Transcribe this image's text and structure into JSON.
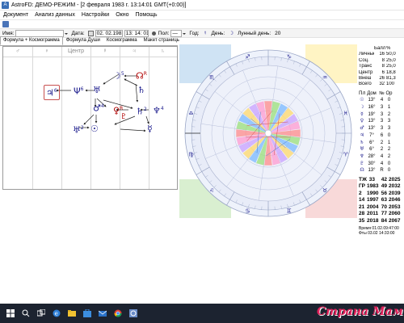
{
  "window": {
    "title": "AstroFD: ДЕМО-РЕЖИМ - [2 февраля 1983 г. 13:14:01 GMT(+0:00)]"
  },
  "menu": [
    "Документ",
    "Анализ данных",
    "Настройки",
    "Окно",
    "Помощь"
  ],
  "fields": {
    "name_label": "Имя:",
    "name_value": "",
    "date_label": "Дата:",
    "date_value": "02. 02.1983",
    "time_value": "13: 14: 01",
    "sex_label": "Пол:",
    "sex_value": "—",
    "year_label": "Год:",
    "day_label": "День:",
    "lunar_label": "Лунный день:",
    "lunar_value": "20"
  },
  "tabs": [
    "Формула + Космограмма",
    "Формула Души",
    "Космограмма",
    "Макет страницы"
  ],
  "formula": {
    "column_headers": [
      "♂",
      "♀",
      "Центр",
      "☿",
      "♃",
      "♄"
    ],
    "planets": [
      {
        "symbol": "♃",
        "sup": "6",
        "boxed": true,
        "red": false
      },
      {
        "symbol": "Ψ",
        "sup": "6",
        "boxed": false,
        "red": false
      },
      {
        "symbol": "♅",
        "sup": "",
        "boxed": false,
        "red": false
      },
      {
        "symbol": "☽",
        "sup": "5",
        "boxed": false,
        "red": false
      },
      {
        "symbol": "☊",
        "sup": "R",
        "boxed": false,
        "red": true
      },
      {
        "symbol": "♄",
        "sup": "",
        "boxed": false,
        "red": false
      },
      {
        "symbol": "♂",
        "sup": "4",
        "boxed": false,
        "red": false
      },
      {
        "symbol": "♀",
        "sup": "R",
        "boxed": false,
        "red": true
      },
      {
        "symbol": "♇",
        "sup": "",
        "boxed": false,
        "red": false
      },
      {
        "symbol": "♄",
        "sup": "2",
        "boxed": false,
        "red": false
      },
      {
        "symbol": "♆",
        "sup": "4",
        "boxed": false,
        "red": false
      },
      {
        "symbol": "♅",
        "sup": "2",
        "boxed": false,
        "red": false
      },
      {
        "symbol": "☉",
        "sup": "",
        "boxed": false,
        "red": false
      },
      {
        "symbol": "☿",
        "sup": "",
        "boxed": false,
        "red": false
      }
    ]
  },
  "stats": {
    "header": [
      "",
      "Балл",
      "%"
    ],
    "rows": [
      [
        "Личные",
        "16",
        "50,0"
      ],
      [
        "Соц.",
        "8",
        "25,0"
      ],
      [
        "Транс",
        "8",
        "25,0"
      ],
      [
        "Центр",
        "6",
        "18,8"
      ],
      [
        "Внеш",
        "26",
        "81,3"
      ],
      [
        "Всего",
        "32",
        "100"
      ]
    ]
  },
  "planet_table": {
    "header": [
      "Пл",
      "Дом",
      "№",
      "Ор"
    ],
    "rows": [
      [
        "☉",
        "13°",
        "4",
        "0"
      ],
      [
        "☽",
        "16°",
        "3",
        "1"
      ],
      [
        "☿",
        "19°",
        "3",
        "2"
      ],
      [
        "♀",
        "13°",
        "3",
        "3"
      ],
      [
        "♂",
        "13°",
        "3",
        "3"
      ],
      [
        "♃",
        "7°",
        "6",
        "0"
      ],
      [
        "♄",
        "6°",
        "2",
        "1"
      ],
      [
        "♅",
        "6°",
        "2",
        "2"
      ],
      [
        "♆",
        "28°",
        "4",
        "2"
      ],
      [
        "♇",
        "30°",
        "4",
        "0"
      ],
      [
        "☊",
        "13°",
        "R",
        "0"
      ]
    ]
  },
  "years": [
    [
      "ТЖ",
      "33",
      "42",
      "2025"
    ],
    [
      "ГР",
      "1983",
      "49",
      "2032"
    ],
    [
      "2",
      "1990",
      "56",
      "2039"
    ],
    [
      "14",
      "1997",
      "63",
      "2046"
    ],
    [
      "21",
      "2004",
      "70",
      "2053"
    ],
    [
      "28",
      "2011",
      "77",
      "2060"
    ],
    [
      "35",
      "2018",
      "84",
      "2067"
    ]
  ],
  "times": [
    "Время 01.02.09:47:00",
    "Фты 03.02 14:33:00"
  ],
  "taskbar": [
    "start",
    "search",
    "task-view",
    "edge",
    "explorer",
    "store",
    "mail",
    "chrome",
    "astro"
  ],
  "watermark": "Страна Мам",
  "zodiac": [
    "♈",
    "♉",
    "♊",
    "♋",
    "♌",
    "♍",
    "♎",
    "♏",
    "♐",
    "♑",
    "♒",
    "♓"
  ],
  "colors": {
    "planet": "#1a1a8c",
    "retro": "#b00000",
    "taskbar": "#1c2330",
    "watermark": "#e0205a"
  }
}
